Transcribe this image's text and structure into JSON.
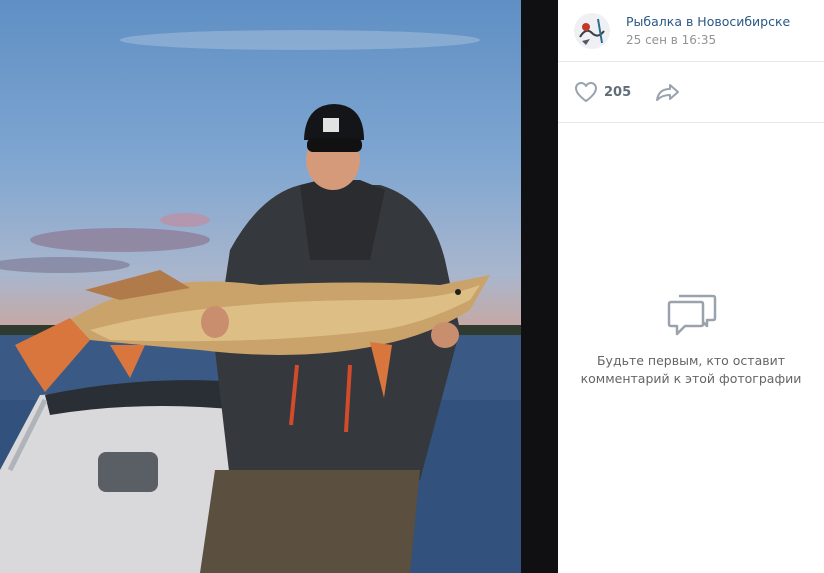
{
  "group": {
    "name": "Рыбалка в Новосибирске",
    "date": "25 сен в 16:35"
  },
  "actions": {
    "like_icon": "heart-outline-icon",
    "likes": "205",
    "share_icon": "share-arrow-icon"
  },
  "comments": {
    "empty_icon": "speech-bubbles-icon",
    "empty_line1": "Будьте первым, кто оставит",
    "empty_line2": "комментарий к этой фотографии"
  },
  "colors": {
    "link": "#2a5885",
    "muted": "#939393",
    "icon": "#99a2ad",
    "divider": "#101012"
  }
}
